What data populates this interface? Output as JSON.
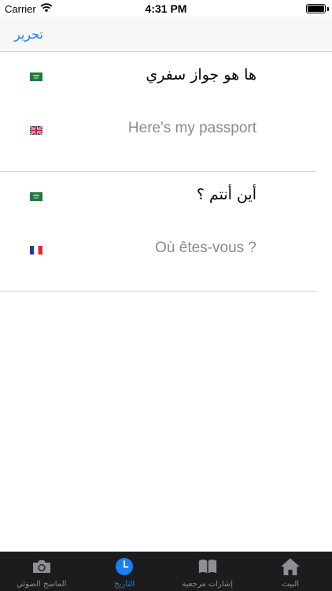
{
  "status_bar": {
    "carrier": "Carrier",
    "time": "4:31 PM"
  },
  "nav": {
    "edit_label": "تحرير"
  },
  "history": [
    {
      "source": {
        "flag": "saudi-arabia-flag-icon",
        "text": "ها هو جواز سفري"
      },
      "target": {
        "flag": "united-kingdom-flag-icon",
        "text": "Here's my passport"
      }
    },
    {
      "source": {
        "flag": "saudi-arabia-flag-icon",
        "text": "أين أنتم ؟"
      },
      "target": {
        "flag": "france-flag-icon",
        "text": "Où êtes-vous ?"
      }
    }
  ],
  "tabs": [
    {
      "label": "الماسح الضوئي",
      "icon": "camera-icon",
      "active": false
    },
    {
      "label": "التاريخ",
      "icon": "clock-icon",
      "active": true
    },
    {
      "label": "إشارات مرجعية",
      "icon": "book-icon",
      "active": false
    },
    {
      "label": "البيت",
      "icon": "home-icon",
      "active": false
    }
  ],
  "colors": {
    "accent": "#1a7ef5",
    "tab_bar_background": "#1c1c1e",
    "tab_inactive": "#8e8e93",
    "secondary_text": "#8a8a8e"
  }
}
